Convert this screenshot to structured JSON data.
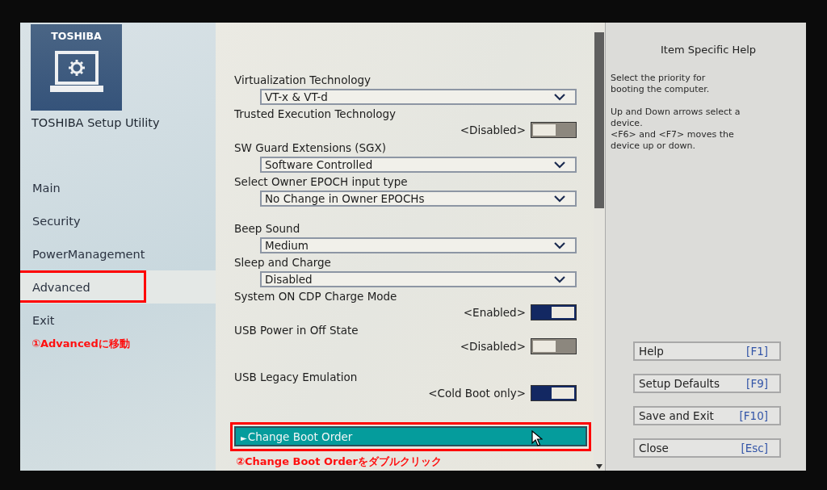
{
  "sidebar": {
    "logo_text": "TOSHIBA",
    "title": "TOSHIBA Setup Utility",
    "items": [
      {
        "label": "Main",
        "selected": false,
        "annotated": false
      },
      {
        "label": "Security",
        "selected": false,
        "annotated": false
      },
      {
        "label": "PowerManagement",
        "selected": false,
        "annotated": false
      },
      {
        "label": "Advanced",
        "selected": true,
        "annotated": true
      },
      {
        "label": "Exit",
        "selected": false,
        "annotated": false
      }
    ],
    "annotation": "①Advancedに移動"
  },
  "settings": {
    "groups": [
      [
        {
          "kind": "dropdown",
          "label": "Virtualization Technology",
          "value": "VT-x & VT-d"
        },
        {
          "kind": "toggle",
          "label": "Trusted Execution Technology",
          "value": "<Disabled>",
          "on": false
        },
        {
          "kind": "dropdown",
          "label": "SW Guard Extensions (SGX)",
          "value": "Software Controlled"
        },
        {
          "kind": "dropdown",
          "label": "Select Owner EPOCH input type",
          "value": "No Change in Owner EPOCHs"
        }
      ],
      [
        {
          "kind": "dropdown",
          "label": "Beep Sound",
          "value": "Medium"
        },
        {
          "kind": "dropdown",
          "label": "Sleep and Charge",
          "value": "Disabled"
        },
        {
          "kind": "toggle",
          "label": "System ON CDP Charge Mode",
          "value": "<Enabled>",
          "on": true
        },
        {
          "kind": "toggle",
          "label": "USB Power in Off State",
          "value": "<Disabled>",
          "on": false
        }
      ],
      [
        {
          "kind": "toggle",
          "label": "USB Legacy Emulation",
          "value": "<Cold Boot only>",
          "on": true
        }
      ],
      [
        {
          "kind": "submenu",
          "arrow": "►",
          "label": "Change Boot Order",
          "selected": true,
          "annotated": true
        }
      ]
    ],
    "annotation": "②Change Boot Orderをダブルクリック"
  },
  "help": {
    "title": "Item Specific Help",
    "paragraphs": [
      [
        "Select the priority for",
        "booting the computer."
      ],
      [
        "Up and Down arrows select a",
        "device.",
        "<F6> and <F7> moves the",
        "device up or down."
      ]
    ]
  },
  "buttons": [
    {
      "label": "Help",
      "key": "[F1]"
    },
    {
      "label": "Setup Defaults",
      "key": "[F9]"
    },
    {
      "label": "Save and Exit",
      "key": "[F10]"
    },
    {
      "label": "Close",
      "key": "[Esc]"
    }
  ]
}
